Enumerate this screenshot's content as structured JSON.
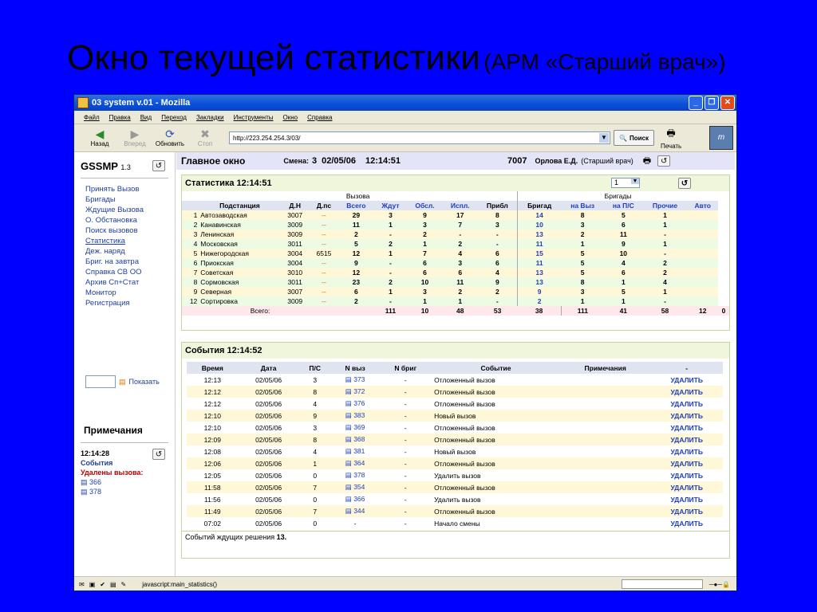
{
  "slide": {
    "title": "Окно текущей статистики",
    "subtitle": "(АРМ «Старший врач»)"
  },
  "window": {
    "title": "03 system v.01 - Mozilla"
  },
  "menu": [
    "Файл",
    "Правка",
    "Вид",
    "Переход",
    "Закладки",
    "Инструменты",
    "Окно",
    "Справка"
  ],
  "nav": {
    "back": "Назад",
    "forward": "Вперед",
    "reload": "Обновить",
    "stop": "Стоп",
    "url": "http://223.254.254.3/03/",
    "search": "Поиск",
    "print": "Печать"
  },
  "brand": {
    "name": "GSSMP",
    "version": "1.3"
  },
  "leftnav": [
    "Принять Вызов",
    "Бригады",
    "Ждущие Вызова",
    "О. Обстановка",
    "Поиск вызовов",
    "Статистика",
    "Деж. наряд",
    "Бриг. на завтра",
    "Справка СВ ОО",
    "Архив Сп+Стат",
    "Монитор",
    "Регистрация"
  ],
  "show_label": "Показать",
  "notes": {
    "title": "Примечания",
    "time": "12:14:28",
    "events": "События",
    "deleted": "Удалены вызова:",
    "links": [
      "366",
      "378"
    ]
  },
  "header": {
    "main": "Главное окно",
    "shift_label": "Смена:",
    "shift": "3",
    "date": "02/05/06",
    "time": "12:14:51",
    "code": "7007",
    "user": "Орлова Е.Д.",
    "role": "(Старший врач)"
  },
  "stats": {
    "title": "Статистика 12:14:51",
    "selector": "1",
    "group_calls": "Вызова",
    "group_brigades": "Бригады",
    "columns": [
      "Подстанция",
      "Д.Н",
      "Д.пс",
      "Всего",
      "Ждут",
      "Обсл.",
      "Испл.",
      "Прибл",
      "Бригад",
      "на Выз",
      "на П/С",
      "Прочие",
      "Авто"
    ],
    "rows": [
      [
        "1",
        "Автозаводская",
        "3007",
        "--",
        "29",
        "3",
        "9",
        "17",
        "8",
        "14",
        "8",
        "5",
        "1",
        ""
      ],
      [
        "2",
        "Канавинская",
        "3009",
        "--",
        "11",
        "1",
        "3",
        "7",
        "3",
        "10",
        "3",
        "6",
        "1",
        ""
      ],
      [
        "3",
        "Ленинская",
        "3009",
        "--",
        "2",
        "-",
        "2",
        "-",
        "-",
        "13",
        "2",
        "11",
        "-",
        ""
      ],
      [
        "4",
        "Московская",
        "3011",
        "--",
        "5",
        "2",
        "1",
        "2",
        "-",
        "11",
        "1",
        "9",
        "1",
        ""
      ],
      [
        "5",
        "Нижегородская",
        "3004",
        "6515",
        "12",
        "1",
        "7",
        "4",
        "6",
        "15",
        "5",
        "10",
        "-",
        ""
      ],
      [
        "6",
        "Приокская",
        "3004",
        "--",
        "9",
        "-",
        "6",
        "3",
        "6",
        "11",
        "5",
        "4",
        "2",
        ""
      ],
      [
        "7",
        "Советская",
        "3010",
        "--",
        "12",
        "-",
        "6",
        "6",
        "4",
        "13",
        "5",
        "6",
        "2",
        ""
      ],
      [
        "8",
        "Сормовская",
        "3011",
        "--",
        "23",
        "2",
        "10",
        "11",
        "9",
        "13",
        "8",
        "1",
        "4",
        ""
      ],
      [
        "9",
        "Северная",
        "3007",
        "--",
        "6",
        "1",
        "3",
        "2",
        "2",
        "9",
        "3",
        "5",
        "1",
        ""
      ],
      [
        "12",
        "Сортировка",
        "3009",
        "--",
        "2",
        "-",
        "1",
        "1",
        "-",
        "2",
        "1",
        "1",
        "-",
        ""
      ]
    ],
    "total": [
      "Всего:",
      "111",
      "10",
      "48",
      "53",
      "38",
      "111",
      "41",
      "58",
      "12",
      "0"
    ]
  },
  "events": {
    "title": "События 12:14:52",
    "columns": [
      "Время",
      "Дата",
      "П/С",
      "N выз",
      "N бриг",
      "Событие",
      "Примечания",
      "-"
    ],
    "rows": [
      [
        "12:13",
        "02/05/06",
        "3",
        "373",
        "-",
        "Отложенный вызов",
        "",
        "УДАЛИТЬ"
      ],
      [
        "12:12",
        "02/05/06",
        "8",
        "372",
        "-",
        "Отложенный вызов",
        "",
        "УДАЛИТЬ"
      ],
      [
        "12:12",
        "02/05/06",
        "4",
        "376",
        "-",
        "Отложенный вызов",
        "",
        "УДАЛИТЬ"
      ],
      [
        "12:10",
        "02/05/06",
        "9",
        "383",
        "-",
        "Новый вызов",
        "",
        "УДАЛИТЬ"
      ],
      [
        "12:10",
        "02/05/06",
        "3",
        "369",
        "-",
        "Отложенный вызов",
        "",
        "УДАЛИТЬ"
      ],
      [
        "12:09",
        "02/05/06",
        "8",
        "368",
        "-",
        "Отложенный вызов",
        "",
        "УДАЛИТЬ"
      ],
      [
        "12:08",
        "02/05/06",
        "4",
        "381",
        "-",
        "Новый вызов",
        "",
        "УДАЛИТЬ"
      ],
      [
        "12:06",
        "02/05/06",
        "1",
        "364",
        "-",
        "Отложенный вызов",
        "",
        "УДАЛИТЬ"
      ],
      [
        "12:05",
        "02/05/06",
        "0",
        "378",
        "-",
        "Удалить вызов",
        "",
        "УДАЛИТЬ"
      ],
      [
        "11:58",
        "02/05/06",
        "7",
        "354",
        "-",
        "Отложенный вызов",
        "",
        "УДАЛИТЬ"
      ],
      [
        "11:56",
        "02/05/06",
        "0",
        "366",
        "-",
        "Удалить вызов",
        "",
        "УДАЛИТЬ"
      ],
      [
        "11:49",
        "02/05/06",
        "7",
        "344",
        "-",
        "Отложенный вызов",
        "",
        "УДАЛИТЬ"
      ],
      [
        "07:02",
        "02/05/06",
        "0",
        "-",
        "-",
        "Начало смены",
        "",
        "УДАЛИТЬ"
      ]
    ],
    "footer_label": "Событий ждущих решения",
    "footer_count": "13."
  },
  "statusbar": {
    "text": "javascript:main_statistics()"
  }
}
